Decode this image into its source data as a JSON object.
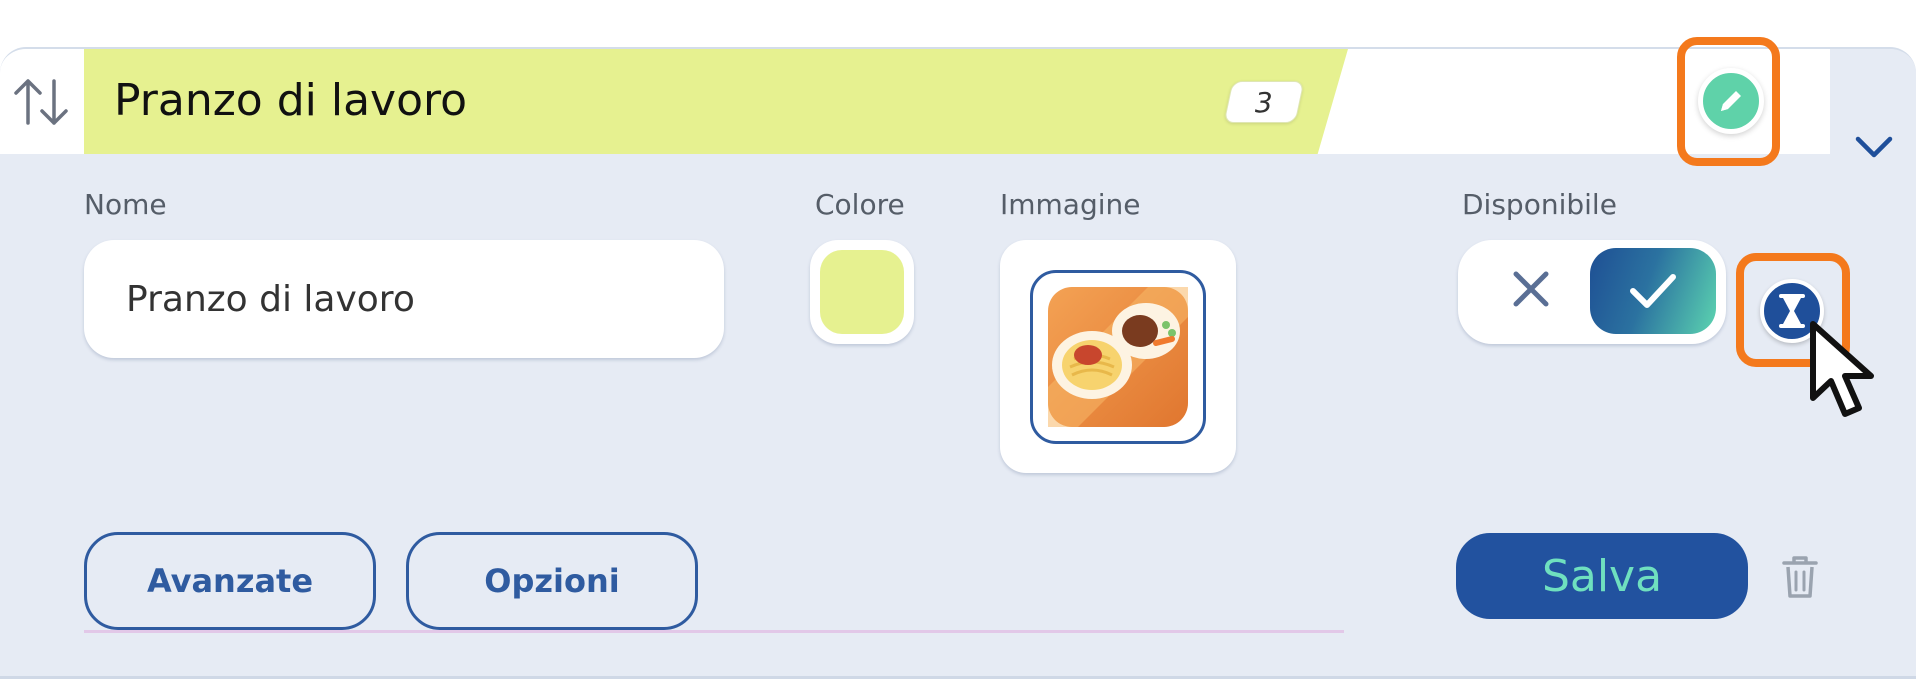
{
  "header": {
    "title": "Pranzo di lavoro",
    "count": "3",
    "title_color": "#e6f190",
    "icons": [
      "sort-arrows-icon",
      "pencil-icon",
      "chevron-down-icon"
    ]
  },
  "form": {
    "name_label": "Nome",
    "name_value": "Pranzo di lavoro",
    "color_label": "Colore",
    "color_value": "#e6f190",
    "image_label": "Immagine",
    "available_label": "Disponibile",
    "available": true
  },
  "buttons": {
    "advanced": "Avanzate",
    "options": "Opzioni",
    "save": "Salva"
  },
  "colors": {
    "accent_orange": "#f4791c",
    "primary_blue": "#22529f",
    "mint": "#5fd2a9",
    "panel_bg": "#e6ebf4"
  }
}
